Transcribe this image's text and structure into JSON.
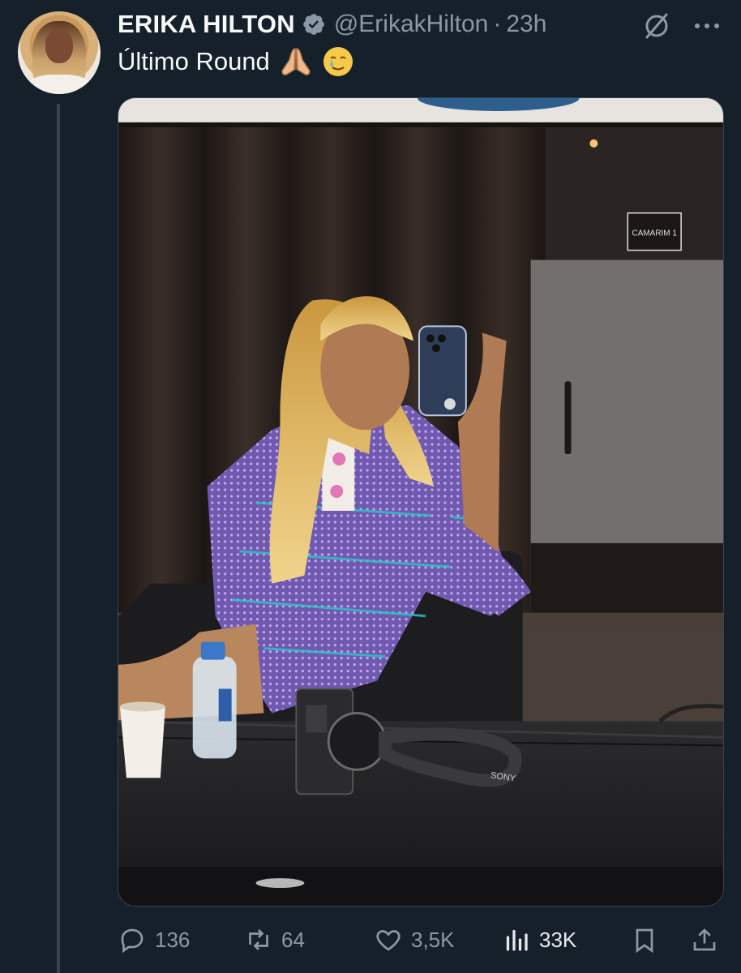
{
  "author": {
    "name": "ERIKA HILTON",
    "handle": "@ErikakHilton",
    "separator": "·",
    "time": "23h",
    "verified": true
  },
  "tweet": {
    "text": "Último Round",
    "emojis": [
      "folded-hands",
      "face-holding-back-tears"
    ]
  },
  "media": {
    "description_icon": "photo",
    "sign_text": "CAMARIM 1",
    "strap_text": "SONY"
  },
  "actions": {
    "replies": "136",
    "retweets": "64",
    "likes": "3,5K",
    "views": "33K"
  },
  "colors": {
    "background": "#15202b",
    "text": "#f7f9f9",
    "muted": "#8b98a5",
    "verified": "#8b98a5",
    "thread_line": "#38444d"
  },
  "icons": [
    "grok-icon",
    "more-icon",
    "verified-icon",
    "reply-icon",
    "retweet-icon",
    "like-icon",
    "views-icon",
    "bookmark-icon",
    "share-icon"
  ]
}
